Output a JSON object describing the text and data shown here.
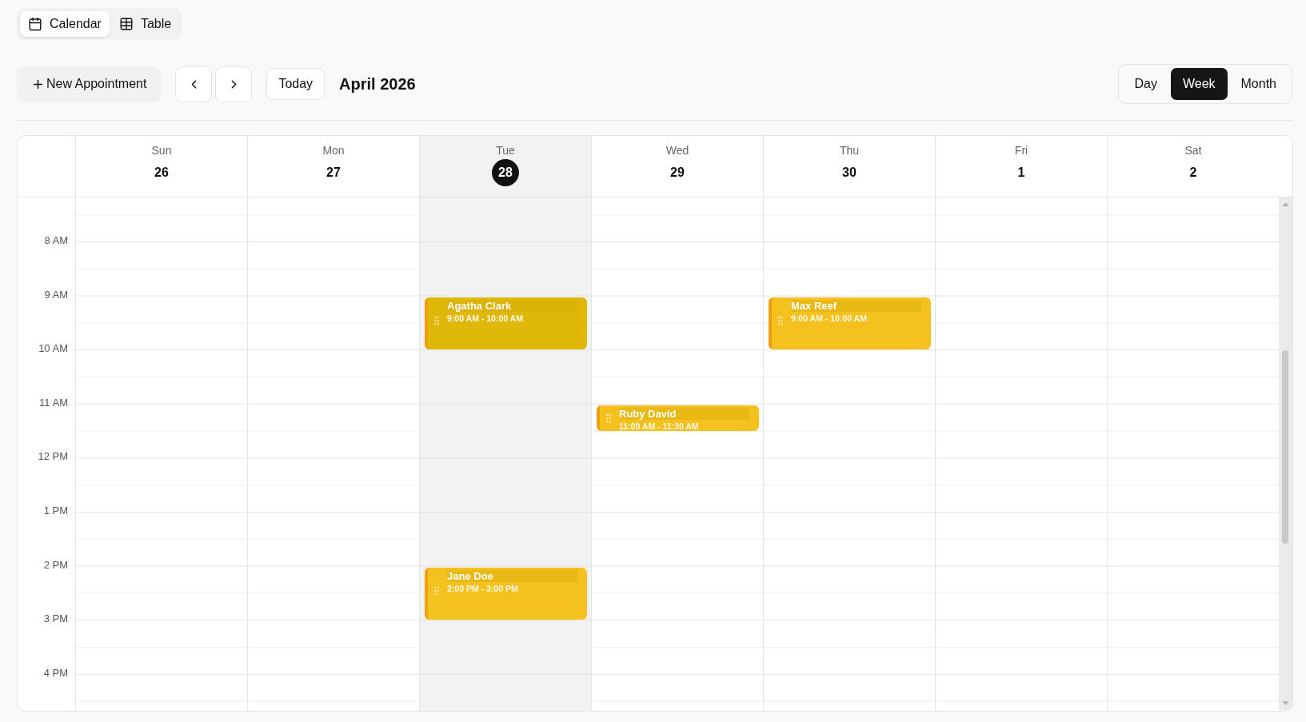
{
  "view_tabs": [
    {
      "kind": "calendar",
      "label": "Calendar",
      "selected": true
    },
    {
      "kind": "table",
      "label": "Table",
      "selected": false
    }
  ],
  "toolbar": {
    "new_button": "New Appointment",
    "today_button": "Today",
    "title": "April 2026",
    "range_options": [
      {
        "label": "Day",
        "selected": false
      },
      {
        "label": "Week",
        "selected": true
      },
      {
        "label": "Month",
        "selected": false
      }
    ]
  },
  "days": [
    {
      "weekday": "Sun",
      "date": "26",
      "today": false
    },
    {
      "weekday": "Mon",
      "date": "27",
      "today": false
    },
    {
      "weekday": "Tue",
      "date": "28",
      "today": true,
      "events": [
        {
          "title": "Agatha Clark",
          "time": "9:00 AM - 10:00 AM",
          "color": "#dfb80a"
        },
        {
          "title": "Jane Doe",
          "time": "2:00 PM - 3:00 PM",
          "color": "#f5c11f"
        }
      ]
    },
    {
      "weekday": "Wed",
      "date": "29",
      "today": false,
      "events": [
        {
          "title": "Ruby David",
          "time": "11:00 AM - 11:30 AM",
          "color": "#f5c11f"
        }
      ]
    },
    {
      "weekday": "Thu",
      "date": "30",
      "today": false,
      "events": [
        {
          "title": "Max Reef",
          "time": "9:00 AM - 10:00 AM",
          "color": "#f5c11f"
        }
      ]
    },
    {
      "weekday": "Fri",
      "date": "1",
      "today": false
    },
    {
      "weekday": "Sat",
      "date": "2",
      "today": false
    }
  ],
  "time_labels": [
    "8 AM",
    "9 AM",
    "10 AM",
    "11 AM",
    "12 PM",
    "1 PM",
    "2 PM",
    "3 PM",
    "4 PM"
  ]
}
